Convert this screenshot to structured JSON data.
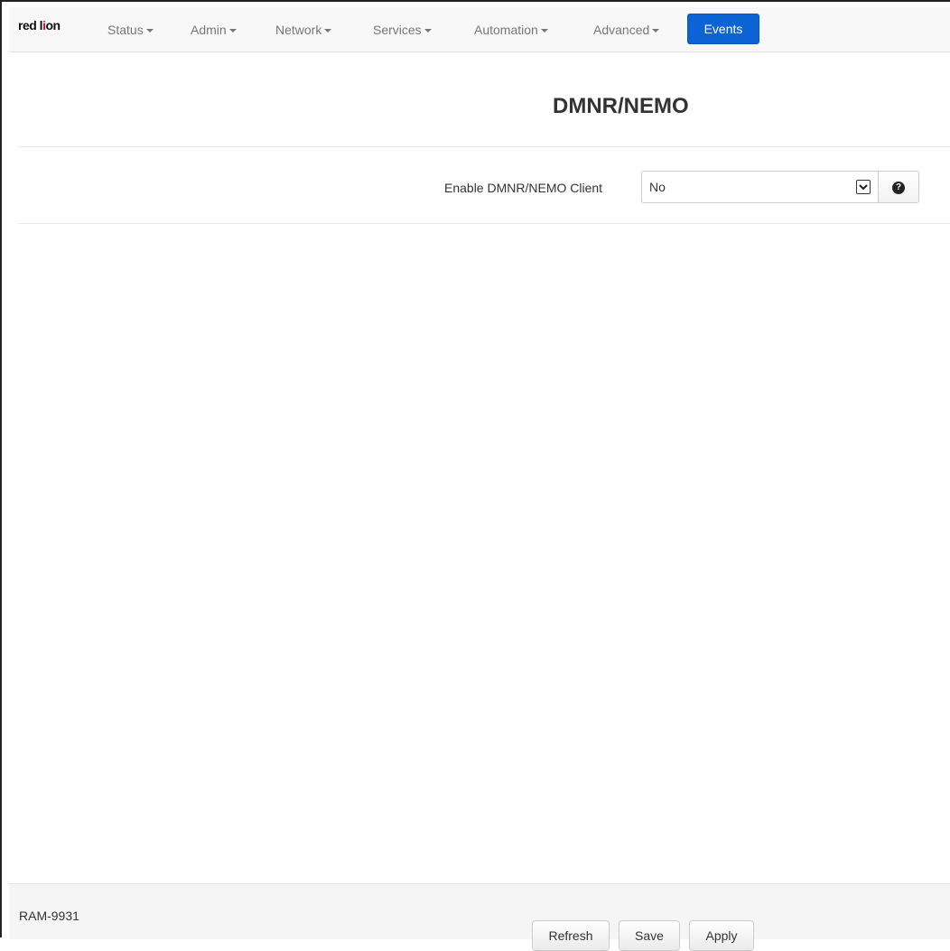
{
  "nav": {
    "logo_part1": "red l",
    "logo_part2": "i",
    "logo_part3": "on",
    "items": [
      {
        "label": "Status"
      },
      {
        "label": "Admin"
      },
      {
        "label": "Network"
      },
      {
        "label": "Services"
      },
      {
        "label": "Automation"
      },
      {
        "label": "Advanced"
      }
    ],
    "active_label": "Events",
    "active_color": "#0b63d4"
  },
  "page": {
    "title": "DMNR/NEMO"
  },
  "form": {
    "enable_label": "Enable DMNR/NEMO Client",
    "enable_value": "No",
    "help_icon": "question-circle-icon",
    "help_glyph": "?"
  },
  "footer": {
    "device": "RAM-9931",
    "refresh_label": "Refresh",
    "save_label": "Save",
    "apply_label": "Apply"
  }
}
